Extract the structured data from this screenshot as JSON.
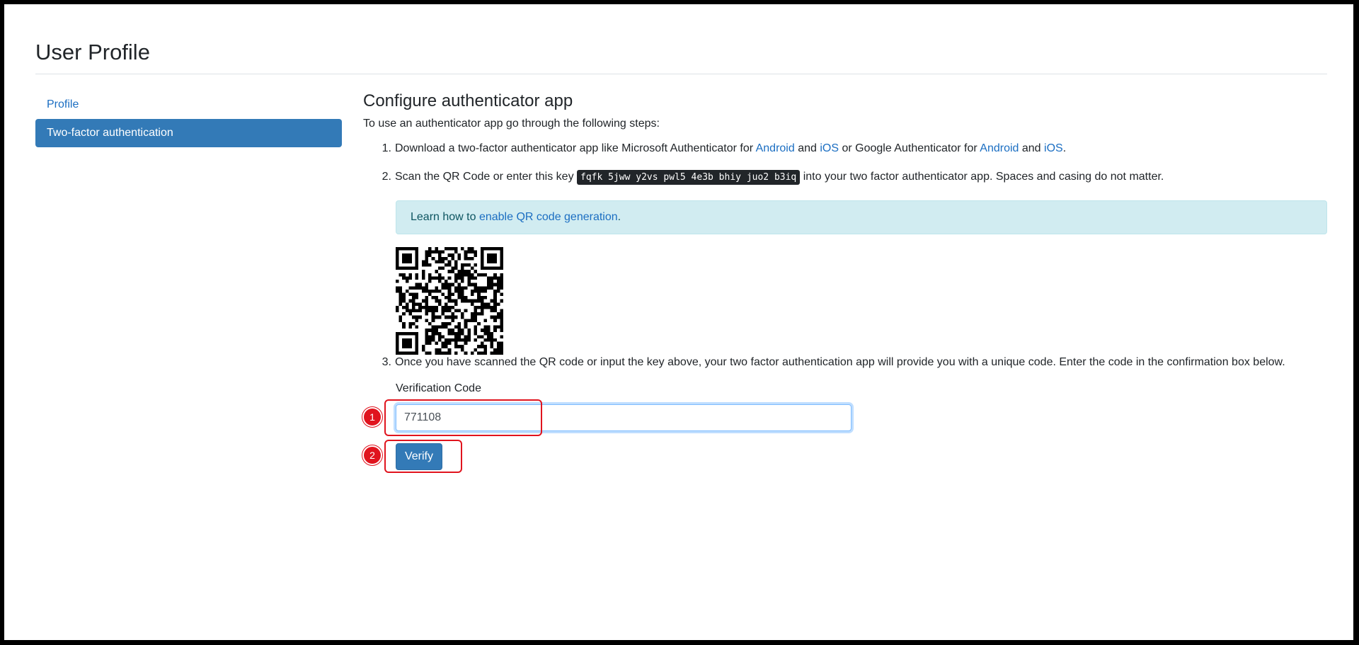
{
  "page": {
    "title": "User Profile"
  },
  "sidebar": {
    "items": [
      {
        "label": "Profile",
        "active": false
      },
      {
        "label": "Two-factor authentication",
        "active": true
      }
    ]
  },
  "main": {
    "heading": "Configure authenticator app",
    "intro": "To use an authenticator app go through the following steps:",
    "step1": {
      "number": "1.",
      "text_a": "Download a two-factor authenticator app like Microsoft Authenticator for ",
      "link_android_1": "Android",
      "text_b": " and ",
      "link_ios_1": "iOS",
      "text_c": " or Google Authenticator for ",
      "link_android_2": "Android",
      "text_d": " and ",
      "link_ios_2": "iOS",
      "text_e": "."
    },
    "step2": {
      "number": "2.",
      "text_a": "Scan the QR Code or enter this key ",
      "key": "fqfk 5jww y2vs pwl5 4e3b bhiy juo2 b3iq",
      "text_b": " into your two factor authenticator app. Spaces and casing do not matter."
    },
    "alert": {
      "text_a": "Learn how to ",
      "link": "enable QR code generation",
      "text_b": "."
    },
    "step3": {
      "number": "3.",
      "text": "Once you have scanned the QR code or input the key above, your two factor authentication app will provide you with a unique code. Enter the code in the confirmation box below."
    },
    "verification": {
      "label": "Verification Code",
      "value": "771108",
      "button_label": "Verify"
    }
  },
  "annotations": {
    "marker_1": "1",
    "marker_2": "2"
  },
  "colors": {
    "accent": "#337ab7",
    "link": "#1b6ec2",
    "marker": "#e0141e",
    "alert_bg": "#d1ecf1"
  }
}
